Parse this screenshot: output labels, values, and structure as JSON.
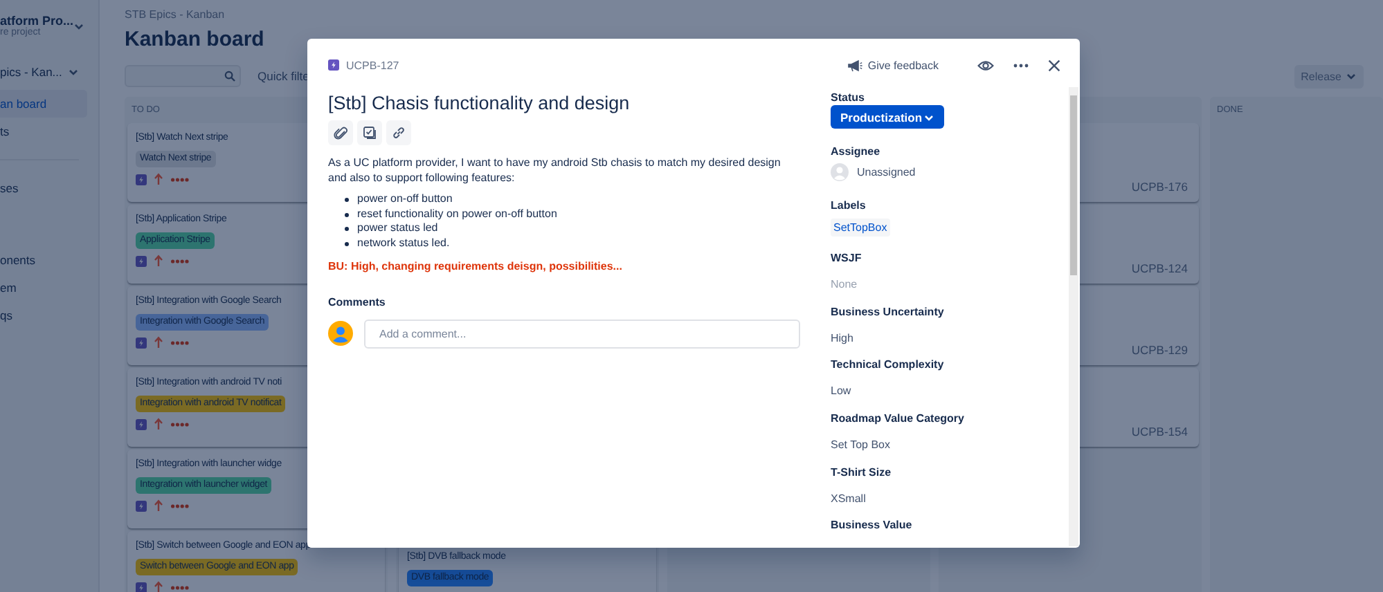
{
  "sidebar": {
    "project": {
      "name": "atform Pro...",
      "type": "re project"
    },
    "board_switcher": "pics - Kan...",
    "items": [
      {
        "label": "an board",
        "selected": true
      },
      {
        "label": "ts",
        "selected": false
      },
      {
        "kind": "divider"
      },
      {
        "label": "ses",
        "selected": false
      },
      {
        "kind": "gap"
      },
      {
        "label": "onents",
        "selected": false
      },
      {
        "label": "em",
        "selected": false
      },
      {
        "label": "qs",
        "selected": false
      }
    ]
  },
  "breadcrumb": "STB Epics - Kanban",
  "title": "Kanban board",
  "quick_filters": "Quick filte",
  "release_button": "Release",
  "columns": [
    {
      "title": "TO DO",
      "cards": [
        {
          "kind": "story",
          "summary": "[Stb] Watch Next stripe",
          "epic": "Watch Next stripe",
          "color": "#6c788d"
        },
        {
          "kind": "story",
          "summary": "[Stb] Application Stripe",
          "epic": "Application Stripe",
          "color": "#2d746f"
        },
        {
          "kind": "story",
          "summary": "[Stb] Integration with Google Search",
          "epic": "Integration with Google Search",
          "color": "#476599"
        },
        {
          "kind": "story",
          "summary": "[Stb] Integration with android TV noti",
          "epic": "Integration with android TV notificat",
          "color": "#7a6a24"
        },
        {
          "kind": "story",
          "summary": "[Stb] Integration with launcher widge",
          "epic": "Integration with launcher widget",
          "color": "#2d746f"
        },
        {
          "kind": "story",
          "summary": "[Stb] Switch between Google and EON app",
          "epic": "Switch between Google and EON app",
          "color": "#7a6a24"
        }
      ]
    },
    {
      "cards": [
        {
          "summary": "[Stb] DVB fallback mode",
          "epic": "DVB fallback mode",
          "color": "#164d99"
        }
      ]
    },
    {},
    {
      "cards": [
        {
          "key": "UCPB-176"
        },
        {
          "key": "UCPB-124"
        },
        {
          "key": "UCPB-129"
        },
        {
          "key": "UCPB-154"
        }
      ]
    },
    {
      "title": "DONE"
    }
  ],
  "issue": {
    "key": "UCPB-127",
    "feedback": "Give feedback",
    "summary": "[Stb] Chasis functionality and design",
    "description": "As a UC platform provider, I want to have my android Stb chasis to match my desired design and also to support following features:",
    "bullets": [
      "power on-off button",
      "reset functionality on power on-off button",
      "power status led",
      "network status led."
    ],
    "note": "BU: High, changing requirements deisgn, possibilities...",
    "comments_heading": "Comments",
    "comment_placeholder": "Add a comment...",
    "fields": [
      {
        "label": "Status",
        "kind": "status",
        "value": "Productization"
      },
      {
        "label": "Assignee",
        "kind": "user",
        "value": "Unassigned"
      },
      {
        "label": "Labels",
        "kind": "label",
        "value": "SetTopBox"
      },
      {
        "label": "WSJF",
        "kind": "none",
        "value": "None"
      },
      {
        "label": "Business Uncertainty",
        "kind": "text",
        "value": "High"
      },
      {
        "label": "Technical Complexity",
        "kind": "text",
        "value": "Low"
      },
      {
        "label": "Roadmap Value Category",
        "kind": "text",
        "value": "Set Top Box"
      },
      {
        "label": "T-Shirt Size",
        "kind": "text",
        "value": "XSmall"
      },
      {
        "label": "Business Value",
        "kind": "text"
      }
    ]
  }
}
